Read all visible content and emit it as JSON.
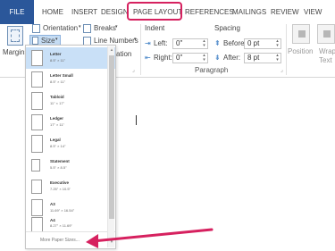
{
  "tabs": {
    "file": "FILE",
    "items": [
      "HOME",
      "INSERT",
      "DESIGN",
      "PAGE LAYOUT",
      "REFERENCES",
      "MAILINGS",
      "REVIEW",
      "VIEW"
    ],
    "active": "PAGE LAYOUT"
  },
  "ribbon": {
    "margins": "Margins",
    "orientation": "Orientation",
    "size": "Size",
    "breaks": "Breaks",
    "line_numbers": "Line Numbers",
    "hyphenation": "ation",
    "indent": {
      "title": "Indent",
      "left_label": "Left:",
      "left_value": "0\"",
      "right_label": "Right:",
      "right_value": "0\""
    },
    "spacing": {
      "title": "Spacing",
      "before_label": "Before:",
      "before_value": "0 pt",
      "after_label": "After:",
      "after_value": "8 pt"
    },
    "paragraph_title": "Paragraph",
    "position": "Position",
    "wrap_text_1": "Wrap",
    "wrap_text_2": "Text"
  },
  "size_menu": {
    "items": [
      {
        "name": "Letter",
        "size": "8.5\" × 11\""
      },
      {
        "name": "Letter Small",
        "size": "8.5\" × 11\""
      },
      {
        "name": "Tabloid",
        "size": "11\" × 17\""
      },
      {
        "name": "Ledger",
        "size": "17\" × 11\""
      },
      {
        "name": "Legal",
        "size": "8.5\" × 14\""
      },
      {
        "name": "Statement",
        "size": "5.5\" × 8.5\""
      },
      {
        "name": "Executive",
        "size": "7.25\" × 10.5\""
      },
      {
        "name": "A3",
        "size": "11.69\" × 16.54\""
      },
      {
        "name": "A4",
        "size": "8.27\" × 11.69\""
      }
    ],
    "selected_index": 0,
    "footer": "More Paper Sizes..."
  },
  "colors": {
    "file_tab": "#2b579a",
    "highlight": "#d6215f",
    "selection": "#c9e0f7"
  }
}
